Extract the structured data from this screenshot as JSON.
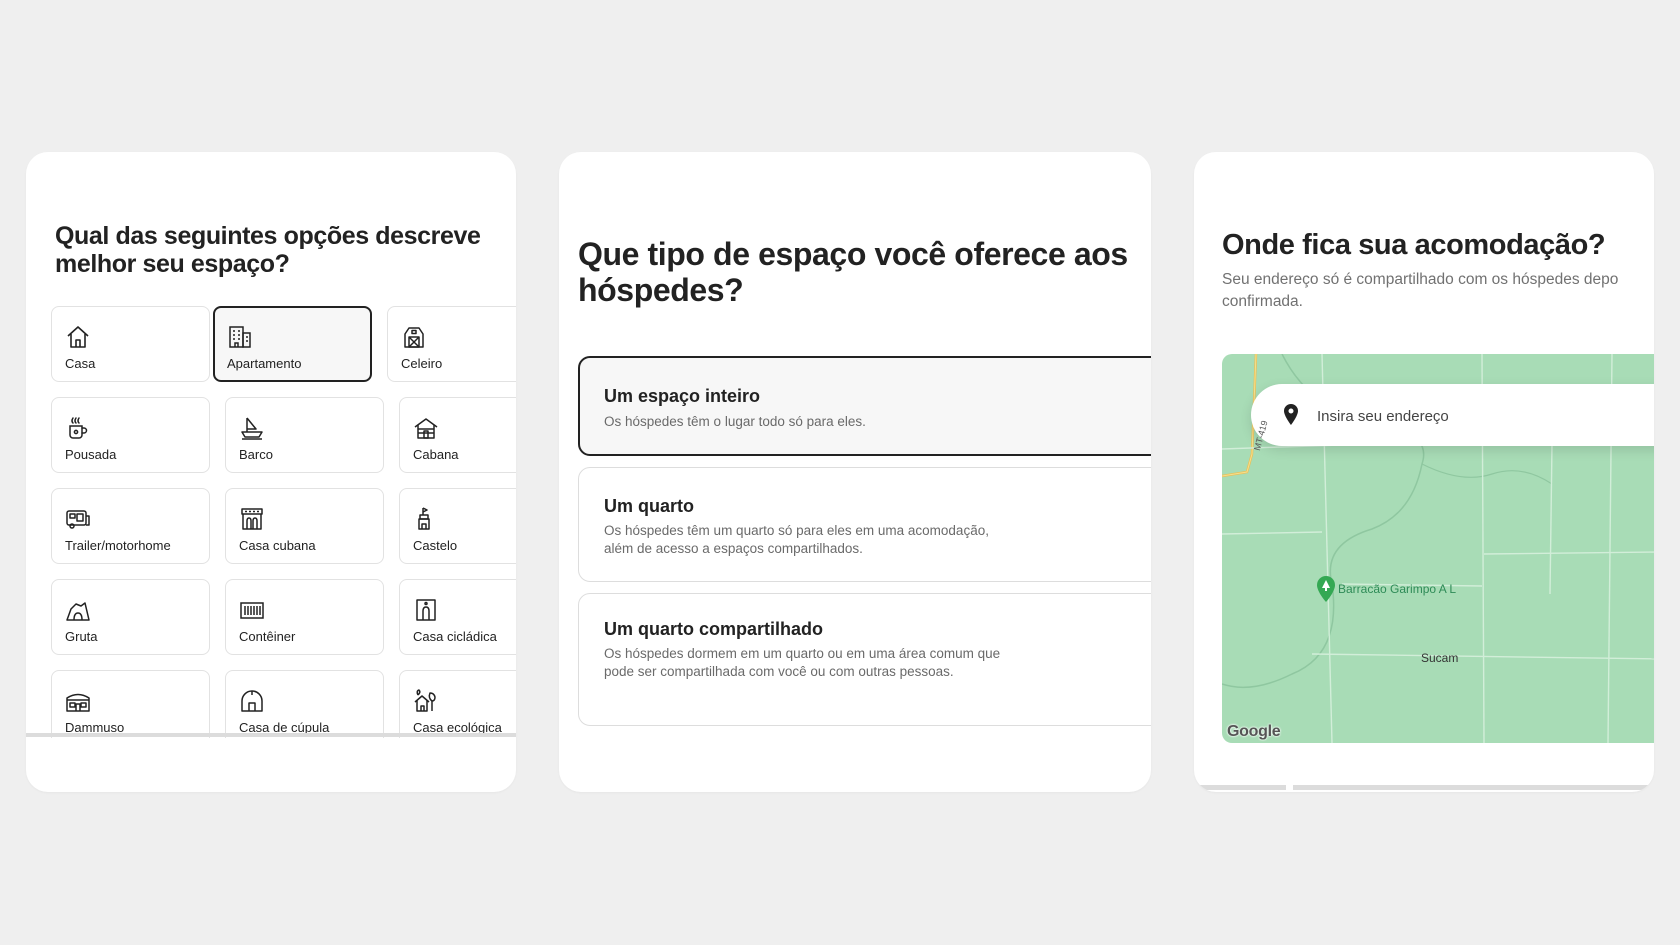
{
  "panel1": {
    "title": "Qual das seguintes opções descreve melhor seu espaço?",
    "types": [
      {
        "label": "Casa",
        "icon": "house-icon",
        "selected": false
      },
      {
        "label": "Apartamento",
        "icon": "apartment-building-icon",
        "selected": true
      },
      {
        "label": "Celeiro",
        "icon": "barn-icon",
        "selected": false
      },
      {
        "label": "Pousada",
        "icon": "coffee-cup-icon",
        "selected": false
      },
      {
        "label": "Barco",
        "icon": "boat-icon",
        "selected": false
      },
      {
        "label": "Cabana",
        "icon": "cabin-icon",
        "selected": false
      },
      {
        "label": "Trailer/motorhome",
        "icon": "camper-van-icon",
        "selected": false
      },
      {
        "label": "Casa cubana",
        "icon": "cuban-house-icon",
        "selected": false
      },
      {
        "label": "Castelo",
        "icon": "castle-icon",
        "selected": false
      },
      {
        "label": "Gruta",
        "icon": "cave-icon",
        "selected": false
      },
      {
        "label": "Contêiner",
        "icon": "container-icon",
        "selected": false
      },
      {
        "label": "Casa cicládica",
        "icon": "cycladic-house-icon",
        "selected": false
      },
      {
        "label": "Dammuso",
        "icon": "dammuso-icon",
        "selected": false
      },
      {
        "label": "Casa de cúpula",
        "icon": "dome-house-icon",
        "selected": false
      },
      {
        "label": "Casa ecológica",
        "icon": "eco-house-icon",
        "selected": false
      }
    ]
  },
  "panel2": {
    "title": "Que tipo de espaço você oferece aos hóspedes?",
    "options": [
      {
        "title": "Um espaço inteiro",
        "description": "Os hóspedes têm o lugar todo só para eles.",
        "selected": true
      },
      {
        "title": "Um quarto",
        "description": "Os hóspedes têm um quarto só para eles em uma acomodação, além de acesso a espaços compartilhados.",
        "selected": false
      },
      {
        "title": "Um quarto compartilhado",
        "description": "Os hóspedes dormem em um quarto ou em uma área comum que pode ser compartilhada com você ou com outras pessoas.",
        "selected": false
      }
    ]
  },
  "panel3": {
    "title": "Onde fica sua acomodação?",
    "subtitle_line1": "Seu endereço só é compartilhado com os hóspedes depo",
    "subtitle_line2": "confirmada.",
    "search": {
      "placeholder": "Insira seu endereço",
      "value": ""
    },
    "map": {
      "poi_label": "Barracão Garimpo A L",
      "town_label": "Sucam",
      "road_label": "MT-419",
      "attribution": "Google",
      "background_color": "#a8dcb6"
    }
  },
  "colors": {
    "selected_border": "#222222",
    "tile_border": "#e2e2e2",
    "muted_text": "#6a6a6a",
    "poi_green": "#34a853"
  }
}
